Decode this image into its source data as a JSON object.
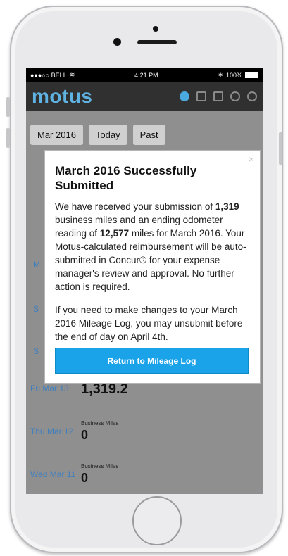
{
  "status_bar": {
    "carrier": "●●●○○ BELL",
    "wifi": "≋",
    "time": "4:21 PM",
    "bluetooth": "∗",
    "battery": "100%"
  },
  "app": {
    "logo": "motus"
  },
  "toolbar": {
    "icons": [
      "clock-icon",
      "document-icon",
      "account-icon",
      "settings-icon",
      "help-icon"
    ],
    "accent": "#4aa9df"
  },
  "tabs": [
    "Mar 2016",
    "Today",
    "Past"
  ],
  "list": [
    {
      "date": "Fri Mar 13",
      "label": "",
      "value": "1,319.2"
    },
    {
      "date": "Thu Mar 12",
      "label": "Business Miles",
      "value": "0"
    },
    {
      "date": "Wed Mar 11",
      "label": "Business Miles",
      "value": "0"
    }
  ],
  "background_fragments": [
    "M",
    "S",
    "S"
  ],
  "modal": {
    "title": "March 2016 Successfully Submitted",
    "p1_a": "We have received your submission of ",
    "p1_miles": "1,319",
    "p1_b": " business miles and an ending odometer reading of ",
    "p1_odometer": "12,577",
    "p1_c": " miles for March 2016. Your Motus-calculated reimbursement will be auto-submitted in Concur® for your expense manager's review and approval. No further action is required.",
    "p2": "If you need to make changes to your March 2016 Mileage Log, you may unsubmit before the end of day on April 4th.",
    "button": "Return to Mileage Log",
    "close": "×",
    "button_color": "#1aa3e8"
  }
}
